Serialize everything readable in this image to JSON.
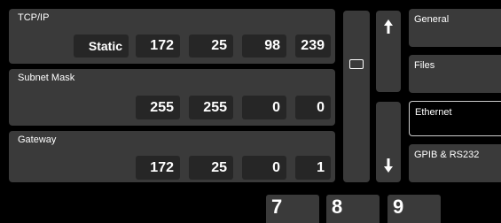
{
  "tcpip": {
    "title": "TCP/IP",
    "mode": "Static",
    "octets": [
      "172",
      "25",
      "98",
      "239"
    ]
  },
  "subnet": {
    "title": "Subnet Mask",
    "octets": [
      "255",
      "255",
      "0",
      "0"
    ]
  },
  "gateway": {
    "title": "Gateway",
    "octets": [
      "172",
      "25",
      "0",
      "1"
    ]
  },
  "nav": {
    "up_icon": "arrow-up-icon",
    "down_icon": "arrow-down-icon"
  },
  "tabs": [
    {
      "label": "General"
    },
    {
      "label": "Files"
    },
    {
      "label": "Ethernet",
      "active": true
    },
    {
      "label": "GPIB & RS232"
    }
  ],
  "keypad": [
    "7",
    "8",
    "9"
  ]
}
